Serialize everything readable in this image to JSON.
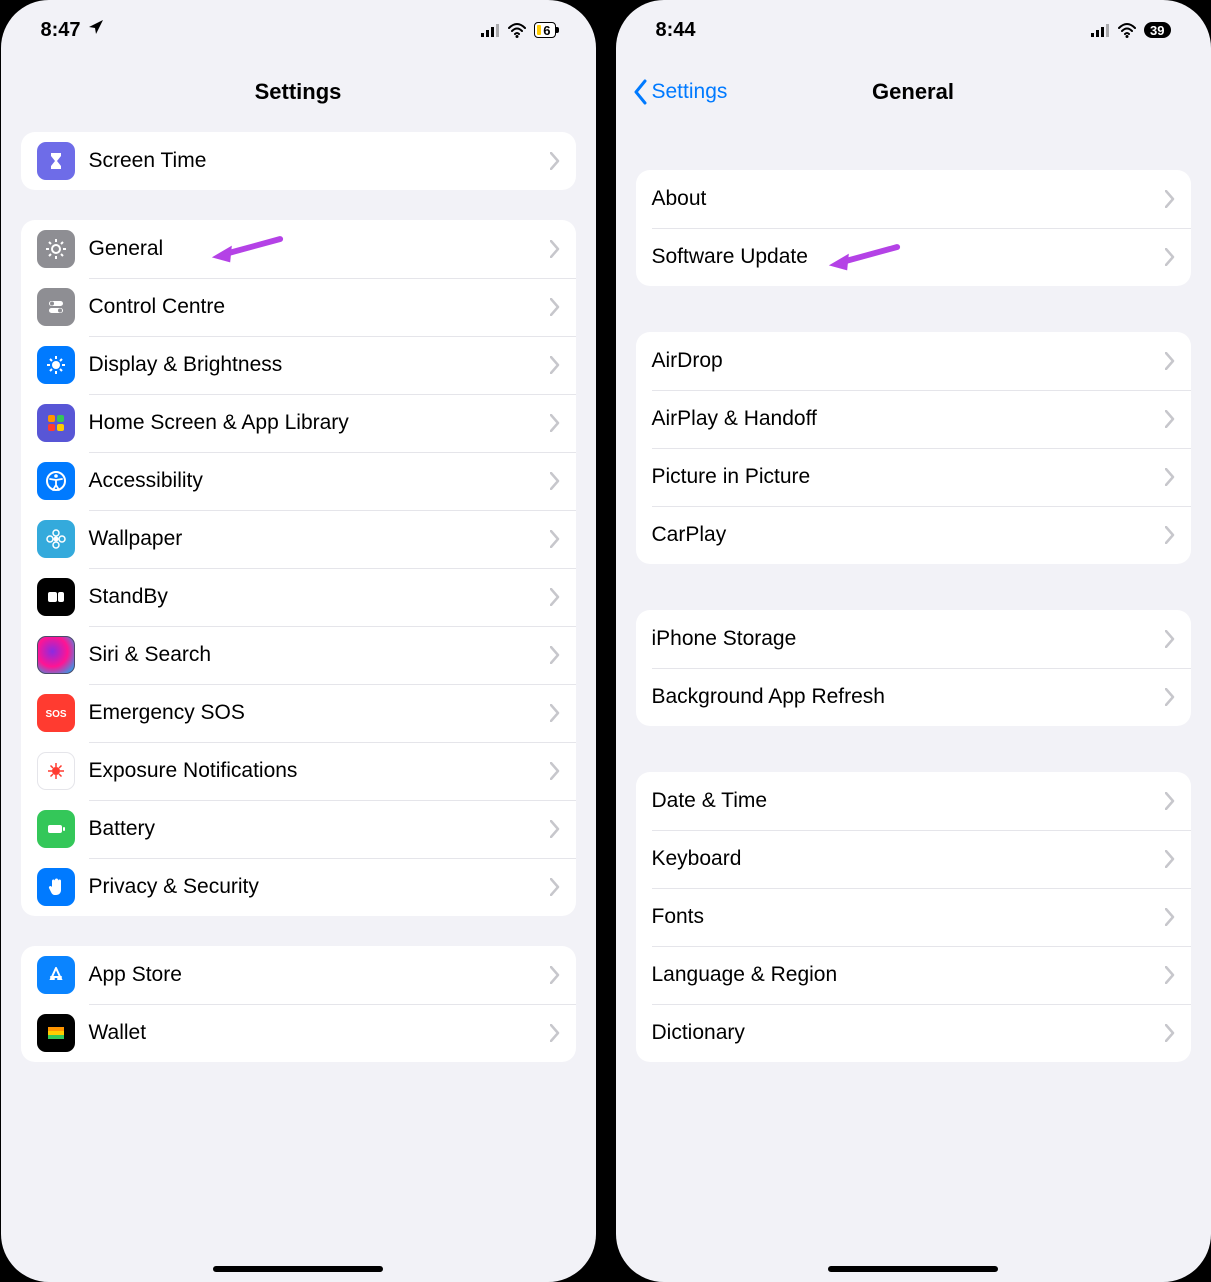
{
  "left": {
    "status": {
      "time": "8:47",
      "battery": "6"
    },
    "title": "Settings",
    "group0": {
      "screen_time": "Screen Time"
    },
    "group1": {
      "general": "General",
      "control_centre": "Control Centre",
      "display_brightness": "Display & Brightness",
      "home_screen": "Home Screen & App Library",
      "accessibility": "Accessibility",
      "wallpaper": "Wallpaper",
      "standby": "StandBy",
      "siri": "Siri & Search",
      "sos": "Emergency SOS",
      "exposure": "Exposure Notifications",
      "battery": "Battery",
      "privacy": "Privacy & Security"
    },
    "group2": {
      "app_store": "App Store",
      "wallet": "Wallet"
    }
  },
  "right": {
    "status": {
      "time": "8:44",
      "battery": "39"
    },
    "back": "Settings",
    "title": "General",
    "g1": {
      "about": "About",
      "software_update": "Software Update"
    },
    "g2": {
      "airdrop": "AirDrop",
      "airplay": "AirPlay & Handoff",
      "pip": "Picture in Picture",
      "carplay": "CarPlay"
    },
    "g3": {
      "storage": "iPhone Storage",
      "bg_refresh": "Background App Refresh"
    },
    "g4": {
      "date_time": "Date & Time",
      "keyboard": "Keyboard",
      "fonts": "Fonts",
      "lang": "Language & Region",
      "dict": "Dictionary"
    }
  },
  "annotation_color": "#b442e6"
}
